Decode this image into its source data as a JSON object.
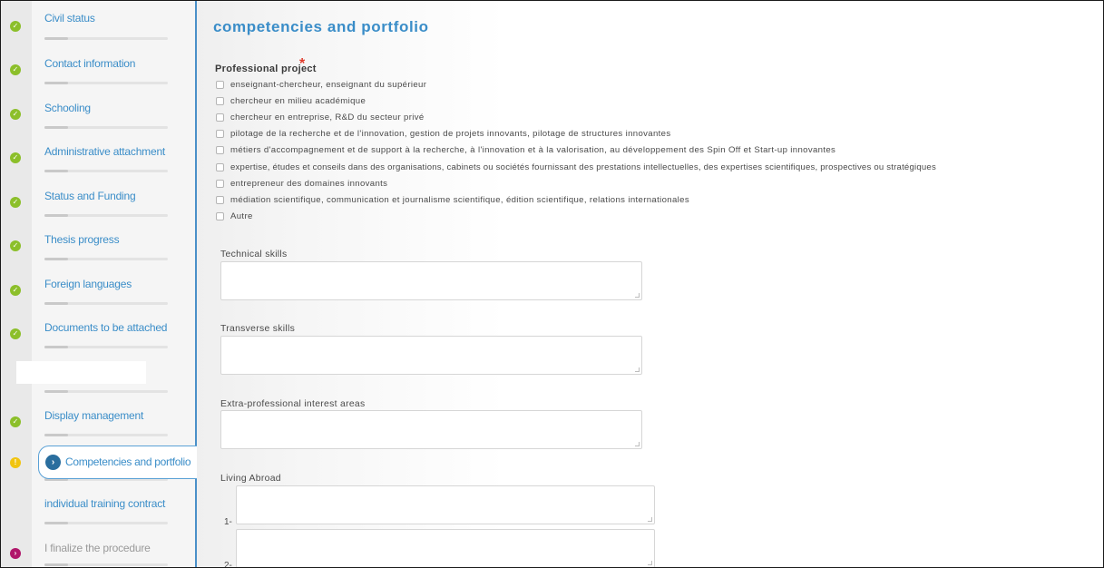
{
  "sidebar": {
    "steps": [
      {
        "label": "Civil status",
        "status": "done"
      },
      {
        "label": "Contact information",
        "status": "done"
      },
      {
        "label": "Schooling",
        "status": "done"
      },
      {
        "label": "Administrative attachment",
        "status": "done"
      },
      {
        "label": "Status and Funding",
        "status": "done"
      },
      {
        "label": "Thesis progress",
        "status": "done"
      },
      {
        "label": "Foreign languages",
        "status": "done"
      },
      {
        "label": "Documents to be attached",
        "status": "done"
      },
      {
        "label": "Display management",
        "status": "done"
      },
      {
        "label": "Competencies and portfolio",
        "status": "warning"
      },
      {
        "label": "individual training contract",
        "status": "none"
      },
      {
        "label": "I finalize the procedure",
        "status": "todo"
      }
    ]
  },
  "main": {
    "title": "competencies and portfolio",
    "professional_project": {
      "label": "Professional project",
      "required_mark": "*",
      "options": [
        "enseignant-chercheur, enseignant du supérieur",
        "chercheur en milieu académique",
        "chercheur en entreprise, R&D du secteur privé",
        "pilotage de la recherche et de l'innovation, gestion de projets innovants, pilotage de structures innovantes",
        "métiers d'accompagnement et de support à la recherche, à l'innovation et à la valorisation, au développement des Spin Off et Start-up innovantes",
        "expertise, études et conseils dans des organisations, cabinets ou sociétés fournissant des prestations intellectuelles, des expertises scientifiques, prospectives ou stratégiques",
        "entrepreneur des domaines innovants",
        "médiation scientifique, communication et journalisme scientifique, édition scientifique, relations internationales",
        "Autre"
      ]
    },
    "technical_skills": {
      "label": "Technical skills",
      "value": ""
    },
    "transverse_skills": {
      "label": "Transverse skills",
      "value": ""
    },
    "extra_professional": {
      "label": "Extra-professional interest areas",
      "value": ""
    },
    "living_abroad": {
      "label": "Living Abroad",
      "rows": [
        "1-",
        "2-"
      ]
    }
  },
  "colors": {
    "accent": "#3a8dc8",
    "done": "#8cbf2a",
    "warning": "#f1c40f",
    "todo": "#b0176b",
    "required": "#e03b2b"
  },
  "icons": {
    "done": "check-circle-icon",
    "warning": "exclamation-circle-icon",
    "todo": "chevron-right-circle-icon",
    "current": "chevron-right-circle-icon"
  }
}
